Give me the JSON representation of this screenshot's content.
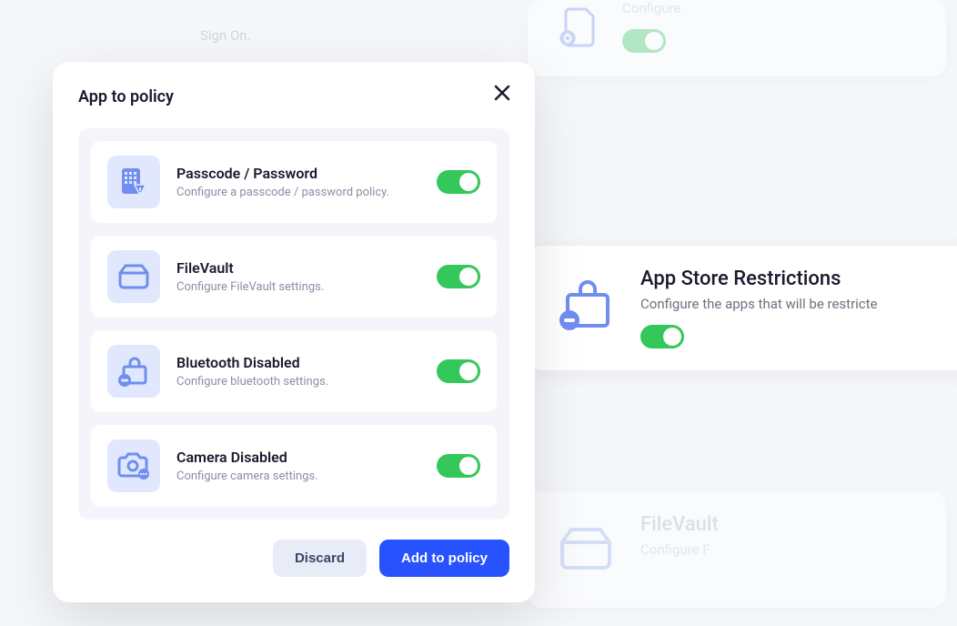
{
  "modal": {
    "title": "App to policy",
    "close_label": "Close",
    "discard_label": "Discard",
    "submit_label": "Add to policy",
    "policies": [
      {
        "name": "Passcode / Password",
        "desc": "Configure a passcode / password policy.",
        "icon": "passcode-icon",
        "enabled": true
      },
      {
        "name": "FileVault",
        "desc": "Configure FileVault settings.",
        "icon": "drive-icon",
        "enabled": true
      },
      {
        "name": "Bluetooth Disabled",
        "desc": "Configure bluetooth settings.",
        "icon": "bag-minus-icon",
        "enabled": true
      },
      {
        "name": "Camera Disabled",
        "desc": "Configure camera settings.",
        "icon": "camera-icon",
        "enabled": true
      }
    ]
  },
  "background": {
    "sign_on_hint": "Sign On.",
    "card_sys": {
      "title": "",
      "desc": "Configure",
      "enabled": true
    },
    "card_appstore": {
      "title": "App Store Restrictions",
      "desc": "Configure the apps that will be restricte",
      "enabled": true
    },
    "card_filevault": {
      "title": "FileVault",
      "desc": "Configure F",
      "enabled": true
    }
  }
}
